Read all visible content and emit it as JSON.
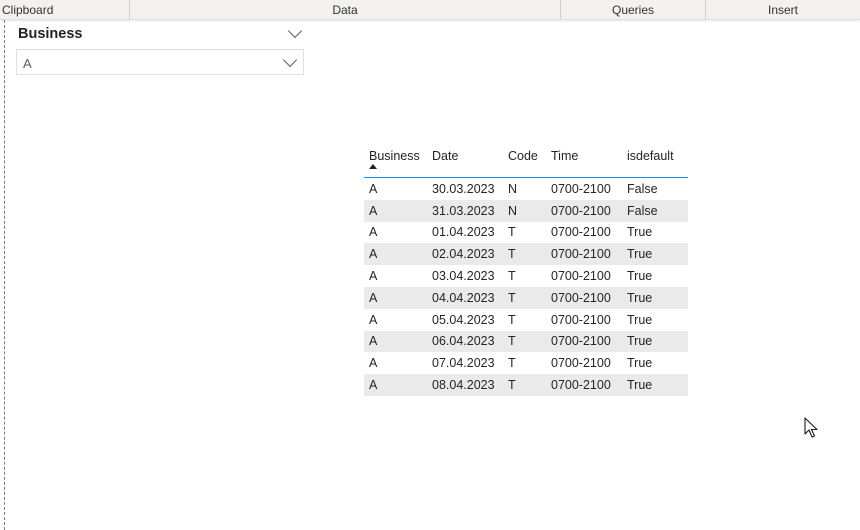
{
  "ribbon": {
    "groups": [
      "Clipboard",
      "Data",
      "Queries",
      "Insert"
    ]
  },
  "slicer": {
    "title": "Business",
    "selected": "A",
    "icons": [
      "chevron-down-icon",
      "chevron-down-icon"
    ]
  },
  "table": {
    "columns": [
      "Business",
      "Date",
      "Code",
      "Time",
      "isdefault"
    ],
    "sort_column": "Business",
    "sort_direction": "ascending",
    "accent_color": "#118dff",
    "rows": [
      [
        "A",
        "30.03.2023",
        "N",
        "0700-2100",
        "False"
      ],
      [
        "A",
        "31.03.2023",
        "N",
        "0700-2100",
        "False"
      ],
      [
        "A",
        "01.04.2023",
        "T",
        "0700-2100",
        "True"
      ],
      [
        "A",
        "02.04.2023",
        "T",
        "0700-2100",
        "True"
      ],
      [
        "A",
        "03.04.2023",
        "T",
        "0700-2100",
        "True"
      ],
      [
        "A",
        "04.04.2023",
        "T",
        "0700-2100",
        "True"
      ],
      [
        "A",
        "05.04.2023",
        "T",
        "0700-2100",
        "True"
      ],
      [
        "A",
        "06.04.2023",
        "T",
        "0700-2100",
        "True"
      ],
      [
        "A",
        "07.04.2023",
        "T",
        "0700-2100",
        "True"
      ],
      [
        "A",
        "08.04.2023",
        "T",
        "0700-2100",
        "True"
      ]
    ]
  }
}
